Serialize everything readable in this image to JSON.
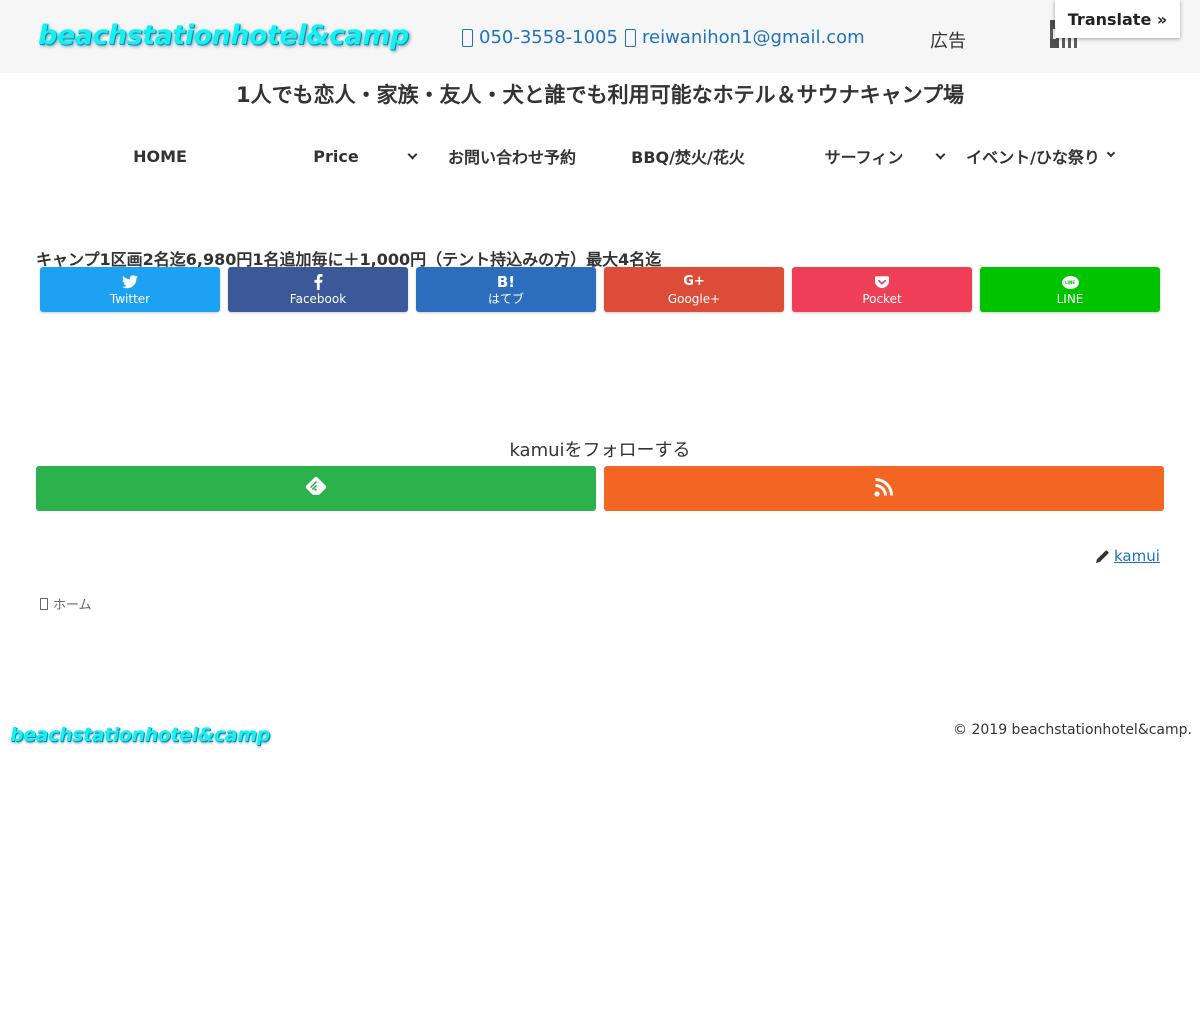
{
  "header": {
    "logo": "beachstationhotel&camp",
    "phone": "050-3558-1005",
    "email": "reiwanihon1@gmail.com",
    "ad_label": "広告",
    "translate_label": "Translate »"
  },
  "tagline": "1人でも恋人・家族・友人・犬と誰でも利用可能なホテル＆サウナキャンプ場",
  "nav": {
    "items": [
      {
        "label": "HOME"
      },
      {
        "label": "Price"
      },
      {
        "label": "お問い合わせ予約"
      },
      {
        "label": "BBQ/焚火/花火"
      },
      {
        "label": "サーフィン"
      },
      {
        "label": "イベント/ひな祭り"
      }
    ]
  },
  "content": {
    "headline": "キャンプ1区画2名迄6,980円1名追加毎に＋1,000円（テント持込みの方）最大4名迄"
  },
  "share": {
    "buttons": [
      {
        "label": "Twitter",
        "icon": "twitter-icon",
        "color": "#1da1f2"
      },
      {
        "label": "Facebook",
        "icon": "facebook-icon",
        "color": "#3b5998"
      },
      {
        "label": "はてブ",
        "icon_text": "B!",
        "icon": "hatena-icon",
        "color": "#2c6ebd"
      },
      {
        "label": "Google+",
        "icon_text": "G+",
        "icon": "google-plus-icon",
        "color": "#dd4b39"
      },
      {
        "label": "Pocket",
        "icon": "pocket-icon",
        "color": "#ef3f56"
      },
      {
        "label": "LINE",
        "icon_text": "LINE",
        "icon": "line-icon",
        "color": "#00c300"
      }
    ]
  },
  "follow": {
    "title": "kamuiをフォローする",
    "buttons": [
      {
        "icon": "feedly-icon",
        "color": "#2bb24c"
      },
      {
        "icon": "rss-icon",
        "color": "#f26522"
      }
    ]
  },
  "author": {
    "name": "kamui"
  },
  "breadcrumb": {
    "home": "ホーム"
  },
  "footer": {
    "logo": "beachstationhotel&camp",
    "copyright": "© 2019 beachstationhotel&camp."
  }
}
